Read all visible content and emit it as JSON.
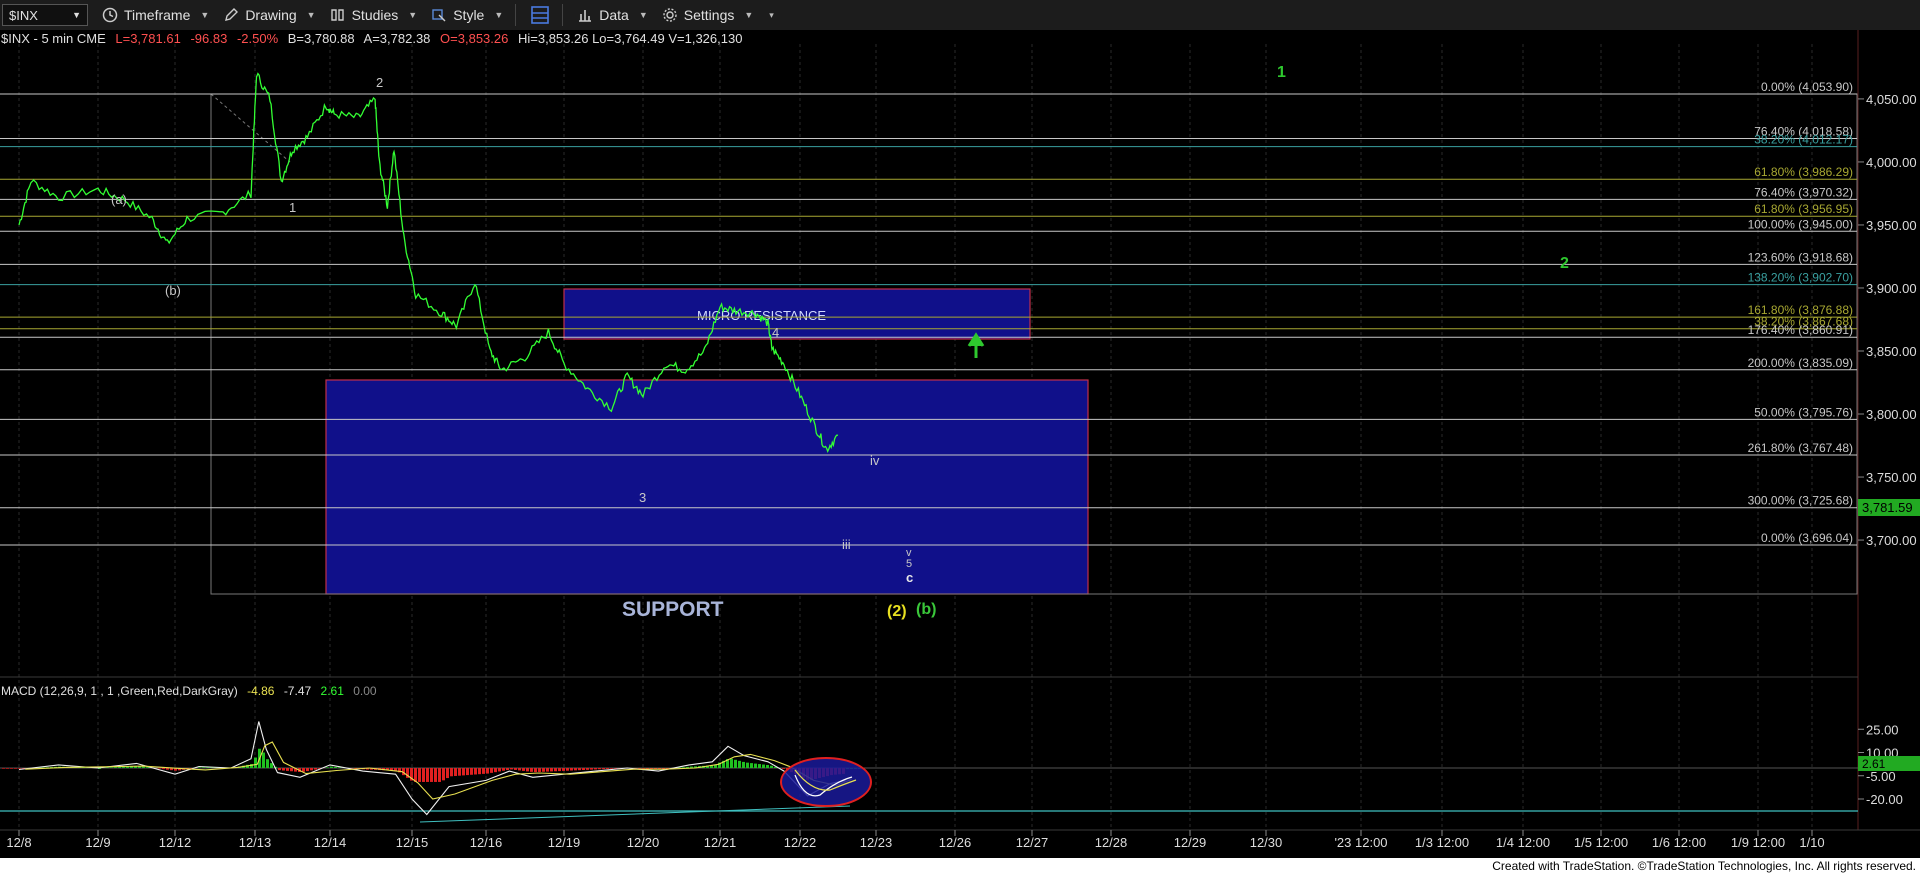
{
  "toolbar": {
    "symbol": "$INX",
    "timeframe": "Timeframe",
    "drawing": "Drawing",
    "studies": "Studies",
    "style": "Style",
    "data": "Data",
    "settings": "Settings"
  },
  "header": {
    "symbol_label": "$INX - 5 min  CME",
    "low": "L=3,781.61",
    "net": "-96.83",
    "pct": "-2.50%",
    "bid": "B=3,780.88",
    "ask": "A=3,782.38",
    "open": "O=3,853.26",
    "hilo": "Hi=3,853.26  Lo=3,764.49  V=1,326,130"
  },
  "price_axis": {
    "ticks": [
      "4,050.00",
      "4,000.00",
      "3,950.00",
      "3,900.00",
      "3,850.00",
      "3,800.00",
      "3,750.00",
      "3,700.00"
    ],
    "current": "3,781.59"
  },
  "macd": {
    "title": "MACD (12,26,9, 1 , 1 ,Green,Red,DarkGray)",
    "v1": "-4.86",
    "v2": "-7.47",
    "v3": "2.61",
    "v4": "0.00",
    "ticks": [
      "25.00",
      "10.00",
      "-5.00",
      "-20.00"
    ],
    "current": "2.61"
  },
  "time_axis": [
    "12/8",
    "12/9",
    "12/12",
    "12/13",
    "12/14",
    "12/15",
    "12/16",
    "12/19",
    "12/20",
    "12/21",
    "12/22",
    "12/23",
    "12/26",
    "12/27",
    "12/28",
    "12/29",
    "12/30",
    "'23 12:00",
    "1/3 12:00",
    "1/4 12:00",
    "1/5 12:00",
    "1/6 12:00",
    "1/9 12:00",
    "1/10"
  ],
  "fib_levels": [
    {
      "label": "0.00% (4,053.90)",
      "color": "#c8c8c8"
    },
    {
      "label": "76.40% (4,018.58)",
      "color": "#c8c8c8"
    },
    {
      "label": "38.20% (4,012.17)",
      "color": "#3aa0a0"
    },
    {
      "label": "61.80% (3,986.29)",
      "color": "#a8a832"
    },
    {
      "label": "76.40% (3,970.32)",
      "color": "#c8c8c8"
    },
    {
      "label": "61.80% (3,956.95)",
      "color": "#a8a832"
    },
    {
      "label": "100.00% (3,945.00)",
      "color": "#c8c8c8"
    },
    {
      "label": "123.60% (3,918.68)",
      "color": "#c8c8c8"
    },
    {
      "label": "138.20% (3,902.70)",
      "color": "#3aa0a0"
    },
    {
      "label": "161.80% (3,876.88)",
      "color": "#a8a832"
    },
    {
      "label": "38.20% (3,867.68)",
      "color": "#a8a832"
    },
    {
      "label": "176.40% (3,860.91)",
      "color": "#c8c8c8"
    },
    {
      "label": "200.00% (3,835.09)",
      "color": "#c8c8c8"
    },
    {
      "label": "50.00% (3,795.76)",
      "color": "#c8c8c8"
    },
    {
      "label": "261.80% (3,767.48)",
      "color": "#c8c8c8"
    },
    {
      "label": "300.00% (3,725.68)",
      "color": "#c8c8c8"
    },
    {
      "label": "0.00% (3,696.04)",
      "color": "#c8c8c8"
    }
  ],
  "zones": {
    "resistance": "MICRO RESISTANCE",
    "support": "SUPPORT"
  },
  "wave_labels": {
    "a": "(a)",
    "b": "(b)",
    "w1": "1",
    "w2": "2",
    "w3": "3",
    "w4": "4",
    "iii": "iii",
    "iv": "iv",
    "v": "v",
    "five": "5",
    "c": "c",
    "big2": "(2)",
    "bigb": "(b)",
    "g1": "1",
    "g2": "2"
  },
  "chart_data": {
    "type": "line",
    "title": "$INX - 5 min",
    "ylim": [
      3680,
      4075
    ],
    "x": [
      "12/8",
      "12/9",
      "12/12",
      "12/13",
      "12/14",
      "12/15",
      "12/16",
      "12/19",
      "12/20",
      "12/21",
      "12/22"
    ],
    "series": [
      {
        "values": [
          3965,
          3960,
          3940,
          3990,
          4045,
          3895,
          3840,
          3820,
          3830,
          3880,
          3775
        ]
      }
    ],
    "macd_series": [
      {
        "values": [
          -1,
          1,
          0,
          28,
          4,
          -20,
          -4,
          -2,
          0,
          6,
          -12
        ]
      }
    ]
  },
  "footer": "Created with TradeStation. ©TradeStation Technologies, Inc. All rights reserved."
}
